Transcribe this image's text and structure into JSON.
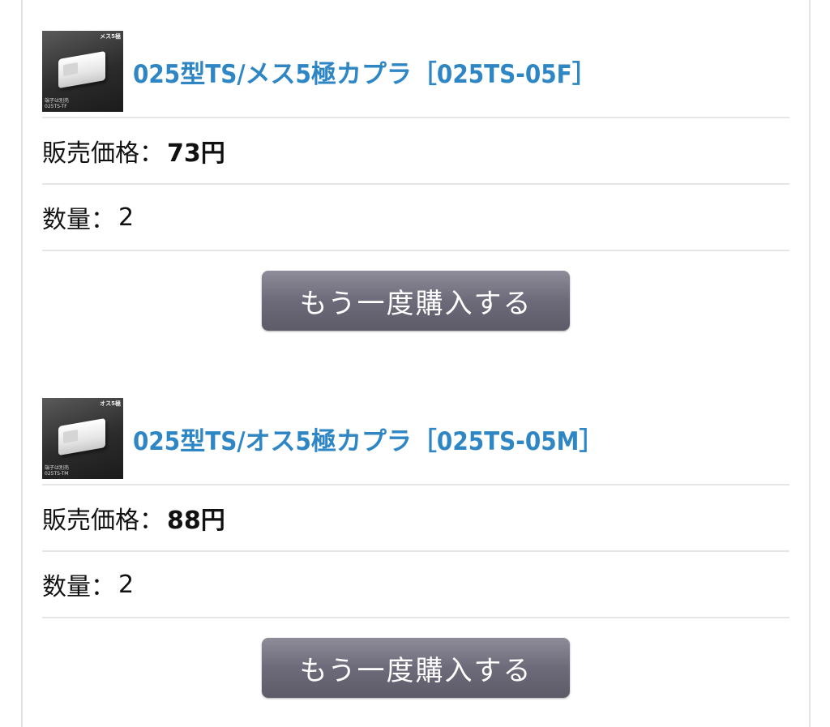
{
  "items": [
    {
      "title": "025型TS/メス5極カプラ［025TS-05F］",
      "price_label": "販売価格：",
      "price_value": "73円",
      "quantity_label": "数量：",
      "quantity_value": "2",
      "rebuy_label": "もう一度購入する",
      "thumb": {
        "corner_text": "メス5極",
        "caption": "端子は別売\n025TS-TF"
      }
    },
    {
      "title": "025型TS/オス5極カプラ［025TS-05M］",
      "price_label": "販売価格：",
      "price_value": "88円",
      "quantity_label": "数量：",
      "quantity_value": "2",
      "rebuy_label": "もう一度購入する",
      "thumb": {
        "corner_text": "オス5極",
        "caption": "端子は別売\n025TS-TM"
      }
    }
  ],
  "colors": {
    "title_link": "#2f86c4",
    "button_bg": "#6d6b79",
    "divider": "#e6e6e6"
  }
}
